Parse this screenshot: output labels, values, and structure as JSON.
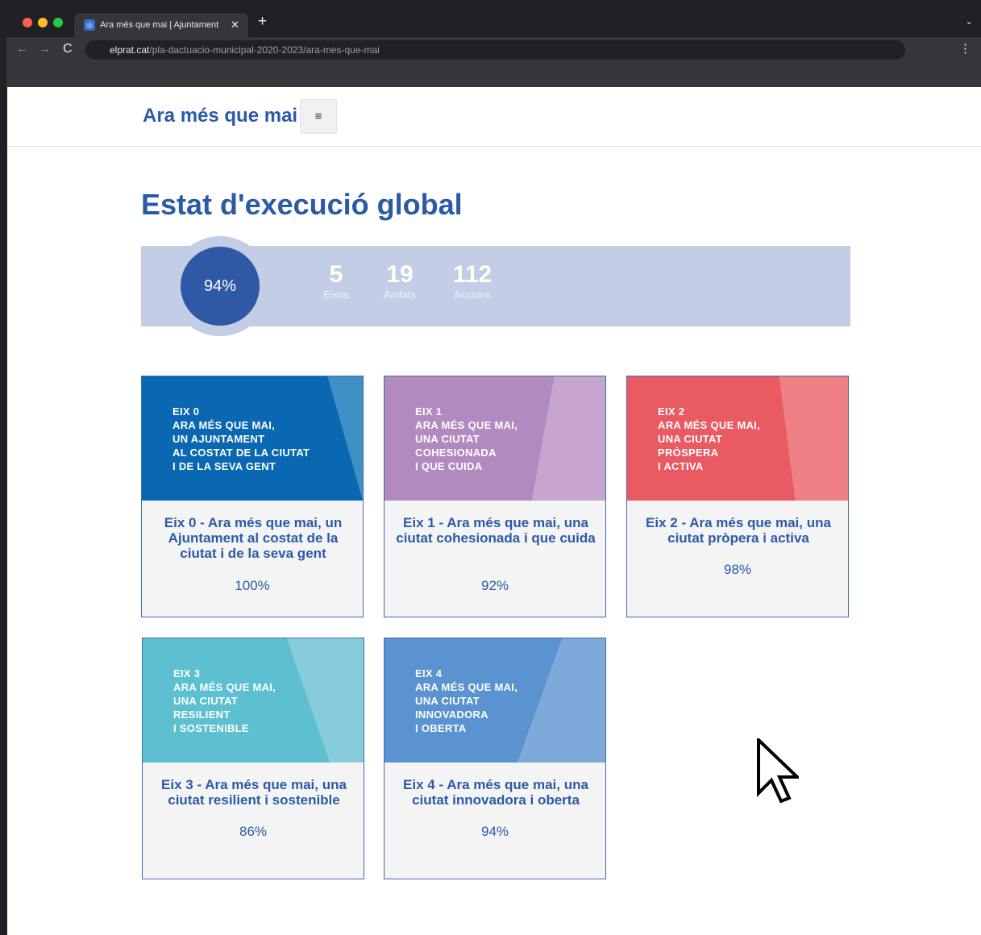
{
  "browser": {
    "tab_title": "Ara més que mai | Ajuntament d",
    "tab_close": "✕",
    "new_tab": "+",
    "tab_menu": "⌄",
    "url_domain": "elprat.cat",
    "url_path": "/pla-dactuacio-municipal-2020-2023/ara-mes-que-mai",
    "nav_back": "←",
    "nav_forward": "→",
    "nav_reload": "C",
    "menu": "⋮"
  },
  "header": {
    "site_title": "Ara més que mai",
    "menu_icon": "≡"
  },
  "page": {
    "heading": "Estat d'execució global"
  },
  "summary": {
    "progress_label": "94%",
    "progress_value": 0.94,
    "stats": [
      {
        "value": "5",
        "label": "Eixos"
      },
      {
        "value": "19",
        "label": "Àmbits"
      },
      {
        "value": "112",
        "label": "Accions"
      }
    ]
  },
  "colors": {
    "brand_blue": "#2b5aa7",
    "donut_fill": "#2f58a6",
    "donut_ring": "#c3cde6"
  },
  "cards": [
    {
      "banner": "EIX 0\nARA MÉS QUE MAI,\nUN AJUNTAMENT\nAL COSTAT DE LA CIUTAT\nI DE LA SEVA GENT",
      "title": "Eix 0 - Ara més que mai, un Ajuntament al costat de la ciutat i de la seva gent",
      "percent": "100%",
      "color": "#0a67b2",
      "accent": "#3f8fc7"
    },
    {
      "banner": "EIX 1\nARA MÉS QUE MAI,\nUNA CIUTAT\nCOHESIONADA\nI QUE CUIDA",
      "title": "Eix 1 - Ara més que mai, una ciutat cohesionada i que cuida",
      "percent": "92%",
      "color": "#b28abf",
      "accent": "#c6a6ce"
    },
    {
      "banner": "EIX 2\nARA MÉS QUE MAI,\nUNA CIUTAT\nPRÒSPERA\nI ACTIVA",
      "title": "Eix 2 - Ara més que mai, una ciutat pròpera i activa",
      "percent": "98%",
      "color": "#ea5a63",
      "accent": "#ef8085"
    },
    {
      "banner": "EIX 3\nARA MÉS QUE MAI,\nUNA CIUTAT\nRESILIENT\nI SOSTENIBLE",
      "title": "Eix 3 - Ara més que mai, una ciutat resilient i sostenible",
      "percent": "86%",
      "color": "#5cc0d1",
      "accent": "#86ccdb"
    },
    {
      "banner": "EIX 4\nARA MÉS QUE MAI,\nUNA CIUTAT\nINNOVADORA\nI OBERTA",
      "title": "Eix 4 - Ara més que mai, una ciutat innovadora i oberta",
      "percent": "94%",
      "color": "#5a93cf",
      "accent": "#7eaada"
    }
  ]
}
